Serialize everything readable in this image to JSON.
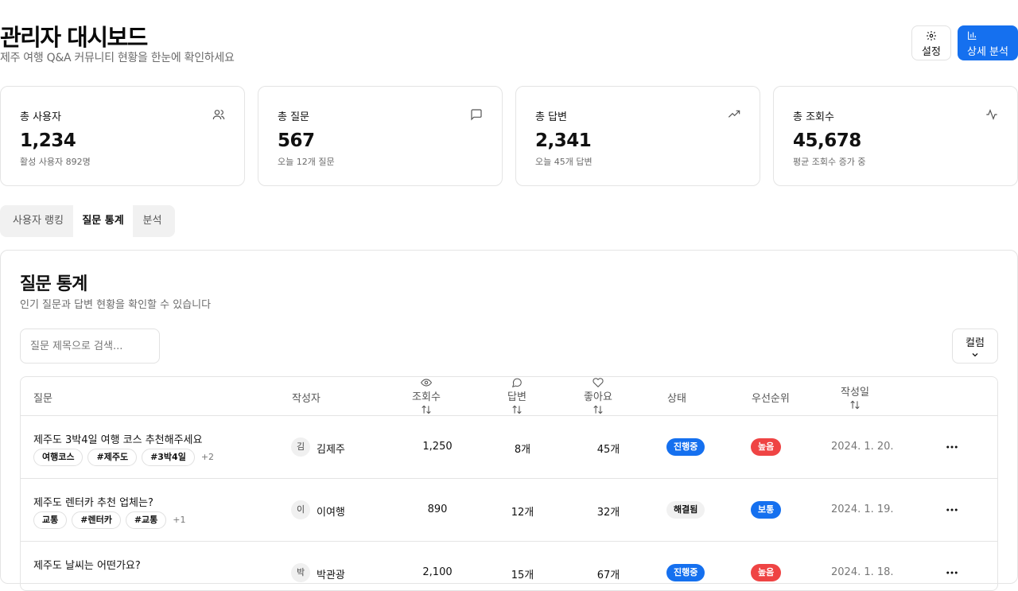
{
  "header": {
    "title": "관리자 대시보드",
    "subtitle": "제주 여행 Q&A 커뮤니티 현황을 한눈에 확인하세요",
    "settings_label": "설정",
    "analysis_label": "상세 분석"
  },
  "colors": {
    "primary": "#1570ef",
    "danger": "#ef4444",
    "neutral_badge": "#f1f1f1"
  },
  "stats": [
    {
      "label": "총 사용자",
      "value": "1,234",
      "sub": "활성 사용자 892명",
      "icon": "users-icon"
    },
    {
      "label": "총 질문",
      "value": "567",
      "sub": "오늘 12개 질문",
      "icon": "message-square-icon"
    },
    {
      "label": "총 답변",
      "value": "2,341",
      "sub": "오늘 45개 답변",
      "icon": "trending-up-icon"
    },
    {
      "label": "총 조회수",
      "value": "45,678",
      "sub": "평균 조회수 증가 중",
      "icon": "activity-icon"
    }
  ],
  "tabs": [
    {
      "label": "사용자 랭킹",
      "active": false
    },
    {
      "label": "질문 통계",
      "active": true
    },
    {
      "label": "분석",
      "active": false
    }
  ],
  "panel": {
    "title": "질문 통계",
    "subtitle": "인기 질문과 답변 현황을 확인할 수 있습니다",
    "search_placeholder": "질문 제목으로 검색...",
    "columns_label": "컬럼"
  },
  "table": {
    "headers": {
      "question": "질문",
      "author": "작성자",
      "views": "조회수",
      "answers": "답변",
      "likes": "좋아요",
      "status": "상태",
      "priority": "우선순위",
      "date": "작성일"
    },
    "rows": [
      {
        "question": "제주도 3박4일 여행 코스 추천해주세요",
        "tags": [
          "여행코스",
          "#제주도",
          "#3박4일"
        ],
        "more": "+2",
        "avatar": "김",
        "author": "김제주",
        "views": "1,250",
        "answers": "8개",
        "likes": "45개",
        "status": "진행중",
        "priority": "높음",
        "date": "2024. 1. 20."
      },
      {
        "question": "제주도 렌터카 추천 업체는?",
        "tags": [
          "교통",
          "#렌터카",
          "#교통"
        ],
        "more": "+1",
        "avatar": "이",
        "author": "이여행",
        "views": "890",
        "answers": "12개",
        "likes": "32개",
        "status": "해결됨",
        "priority": "보통",
        "date": "2024. 1. 19."
      },
      {
        "question": "제주도 날씨는 어떤가요?",
        "tags": [],
        "more": "",
        "avatar": "박",
        "author": "박관광",
        "views": "2,100",
        "answers": "15개",
        "likes": "67개",
        "status": "진행중",
        "priority": "높음",
        "date": "2024. 1. 18."
      }
    ]
  }
}
